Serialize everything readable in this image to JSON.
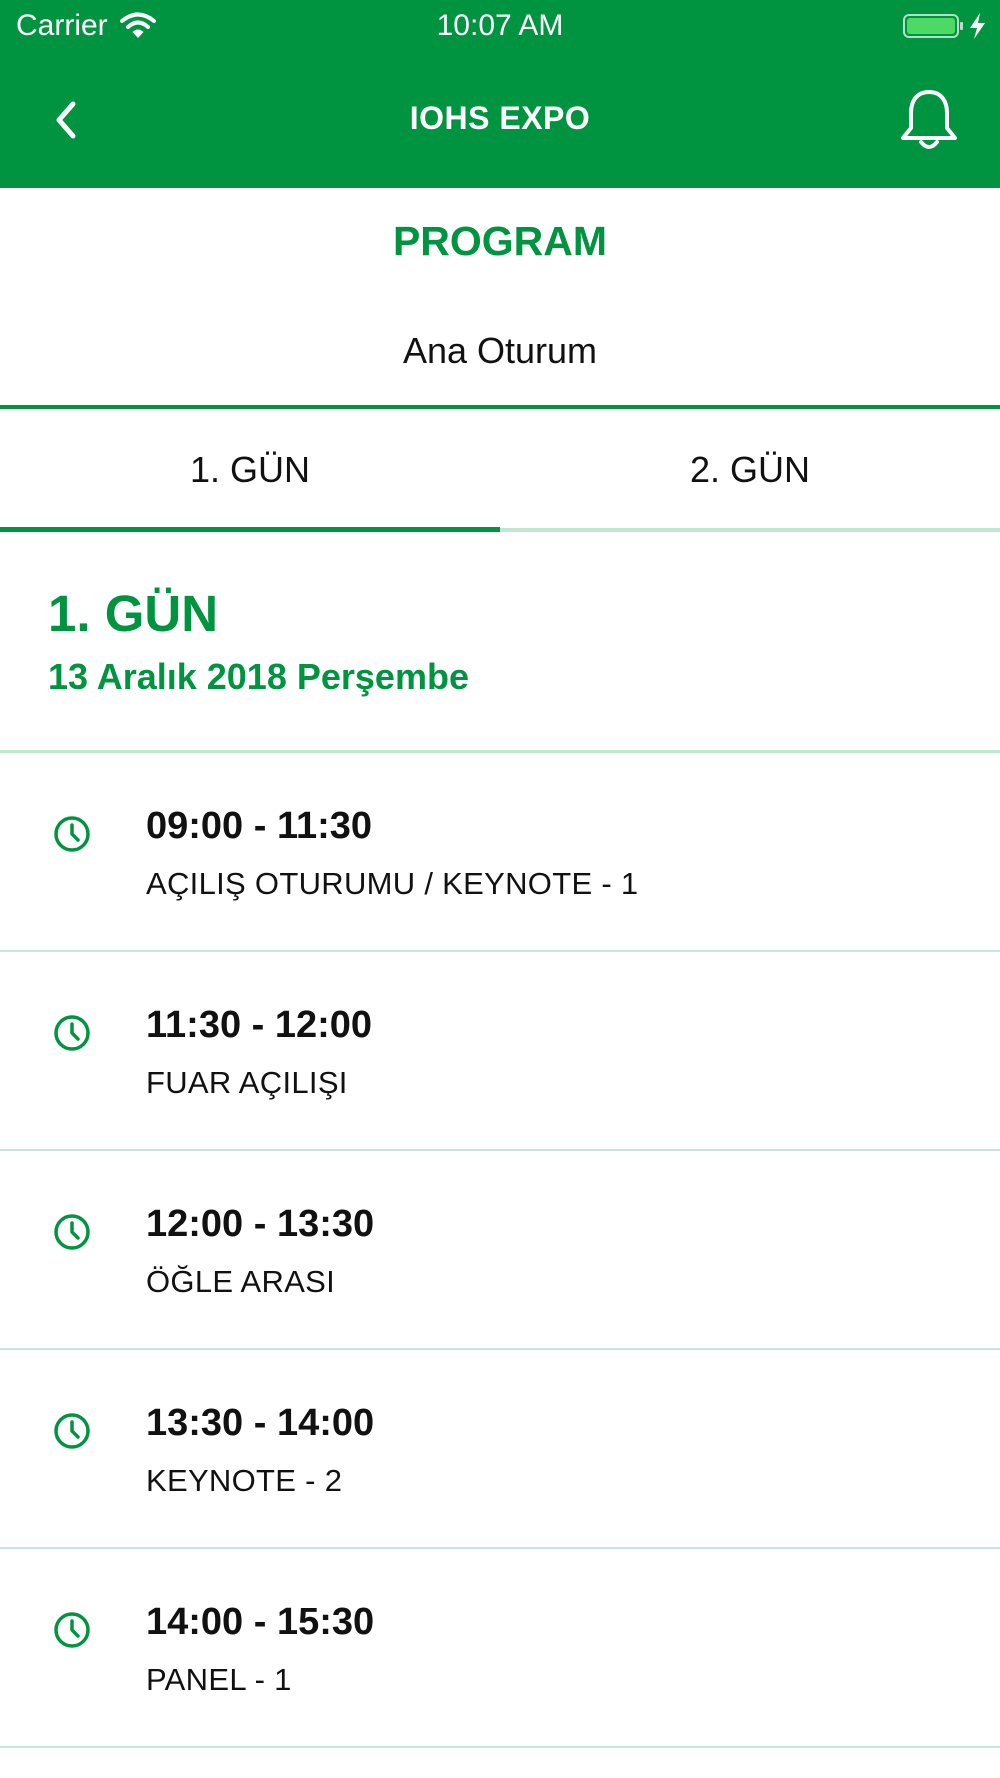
{
  "status_bar": {
    "carrier": "Carrier",
    "time": "10:07 AM",
    "icons": [
      "wifi-icon",
      "battery-icon",
      "charging-bolt-icon"
    ]
  },
  "nav": {
    "title": "IOHS EXPO",
    "back_icon": "chevron-left-icon",
    "notification_icon": "bell-icon"
  },
  "page": {
    "section_title": "PROGRAM",
    "session_name": "Ana Oturum"
  },
  "tabs": [
    {
      "label": "1. GÜN",
      "active": true
    },
    {
      "label": "2. GÜN",
      "active": false
    }
  ],
  "day": {
    "heading": "1. GÜN",
    "date": "13 Aralık 2018 Perşembe"
  },
  "schedule": [
    {
      "time": "09:00 - 11:30",
      "title": "AÇILIŞ OTURUMU / KEYNOTE - 1"
    },
    {
      "time": "11:30 - 12:00",
      "title": "FUAR AÇILIŞI"
    },
    {
      "time": "12:00 - 13:30",
      "title": "ÖĞLE ARASI"
    },
    {
      "time": "13:30 - 14:00",
      "title": "KEYNOTE - 2"
    },
    {
      "time": "14:00 - 15:30",
      "title": "PANEL - 1"
    }
  ],
  "colors": {
    "brand_green": "#009440",
    "light_green_divider": "#bfe6cf",
    "battery_fill": "#4cd964"
  }
}
